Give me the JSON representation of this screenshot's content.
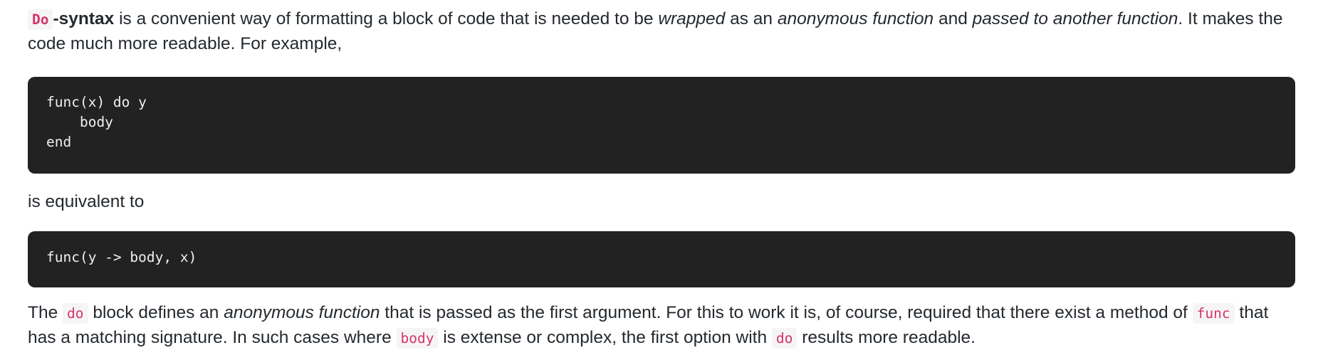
{
  "paragraph1": {
    "code_do": "Do",
    "syntax_bold": "-syntax",
    "t1": " is a convenient way of formatting a block of code that is needed to be ",
    "em_wrapped": "wrapped",
    "t2": " as an ",
    "em_anonymous": "anonymous function",
    "t3": " and ",
    "em_passed": "passed to another function",
    "t4": ". It makes the code much more readable. For example,"
  },
  "code_block_1": "func(x) do y\n    body\nend",
  "paragraph2": "is equivalent to",
  "code_block_2": "func(y -> body, x)",
  "paragraph3": {
    "t1": "The ",
    "code_do": "do",
    "t2": " block defines an ",
    "em_anonymous": "anonymous function",
    "t3": " that is passed as the first argument. For this to work it is, of course, required that there exist a method of ",
    "code_func": "func",
    "t4": " that has a matching signature. In such cases where ",
    "code_body": "body",
    "t5": " is extense or complex, the first option with ",
    "code_do2": "do",
    "t6": " results more readable."
  }
}
